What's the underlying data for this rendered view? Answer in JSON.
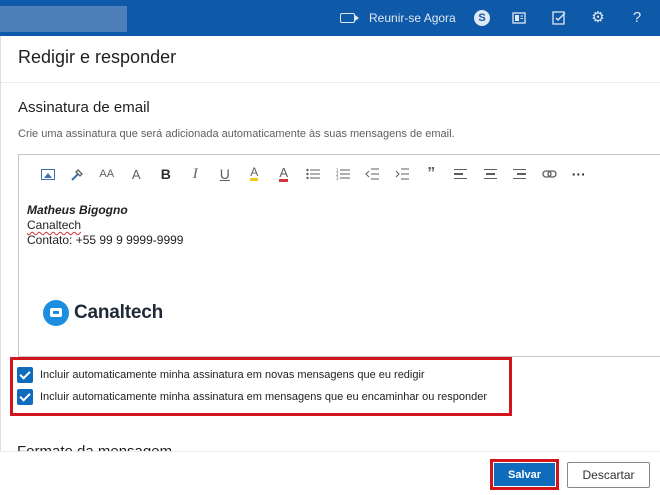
{
  "topbar": {
    "meet_label": "Reunir-se Agora",
    "icons": [
      "video-icon",
      "skype-icon",
      "whats-new-icon",
      "my-day-icon",
      "settings-icon",
      "help-icon"
    ],
    "colors": {
      "bar": "#0f5aa8"
    }
  },
  "panel": {
    "title": "Redigir e responder"
  },
  "signature_section": {
    "title": "Assinatura de email",
    "description": "Crie uma assinatura que será adicionada automaticamente às suas mensagens de email.",
    "toolbar_icons": [
      "insert-picture-icon",
      "format-painter-icon",
      "font-size-icon",
      "grow-font-icon",
      "bold-icon",
      "italic-icon",
      "underline-icon",
      "highlight-icon",
      "font-color-icon",
      "bullets-icon",
      "numbering-icon",
      "decrease-indent-icon",
      "increase-indent-icon",
      "quote-icon",
      "align-left-icon",
      "align-center-icon",
      "align-right-icon",
      "link-icon",
      "more-options-icon"
    ],
    "toolbar_glyphs": {
      "font_size": "AA",
      "grow_font": "A",
      "bold": "B",
      "italic": "I",
      "underline": "U",
      "highlight": "A",
      "font_color": "A",
      "quote": "”",
      "more": "···"
    },
    "content": {
      "name": "Matheus Bigogno",
      "company": "Canaltech",
      "contact": "Contato: +55 99 9 9999-9999",
      "logo_text": "Canaltech"
    },
    "options": [
      {
        "label": "Incluir automaticamente minha assinatura em novas mensagens que eu redigir",
        "checked": true
      },
      {
        "label": "Incluir automaticamente minha assinatura em mensagens que eu encaminhar ou responder",
        "checked": true
      }
    ]
  },
  "next_section_partial": "Formato da mensagem",
  "footer": {
    "save_label": "Salvar",
    "discard_label": "Descartar",
    "colors": {
      "primary": "#0f6cbd",
      "highlight": "#d4141b"
    }
  }
}
